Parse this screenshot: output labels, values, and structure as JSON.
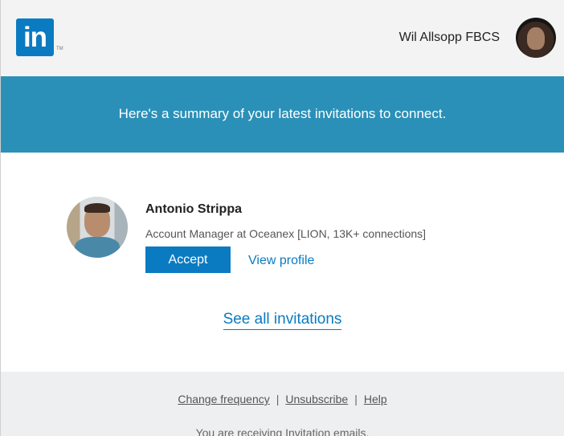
{
  "header": {
    "logo_text": "in",
    "logo_tm": "TM",
    "user_name": "Wil Allsopp FBCS"
  },
  "banner": {
    "text": "Here's a summary of your latest invitations to connect."
  },
  "invitation": {
    "name": "Antonio Strippa",
    "headline": "Account Manager at Oceanex [LION, 13K+ connections]",
    "accept_label": "Accept",
    "view_profile_label": "View profile"
  },
  "see_all_label": "See all invitations",
  "footer": {
    "links": [
      "Change frequency",
      "Unsubscribe",
      "Help"
    ],
    "separator": "|",
    "note": "You are receiving Invitation emails."
  },
  "colors": {
    "brand_blue": "#0a7bc1",
    "banner_blue": "#2b90b8",
    "header_bg": "#f3f3f3",
    "footer_bg": "#eeeff1"
  }
}
